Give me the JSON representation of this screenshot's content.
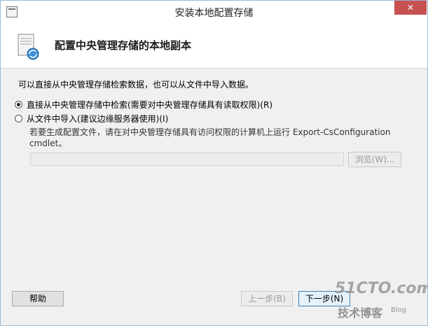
{
  "window": {
    "title": "安装本地配置存储",
    "close_label": "✕"
  },
  "header": {
    "title": "配置中央管理存储的本地副本"
  },
  "intro_text": "可以直接从中央管理存储检索数据，也可以从文件中导入数据。",
  "options": [
    {
      "label": "直接从中央管理存储中检索(需要对中央管理存储具有读取权限)(R)",
      "checked": true
    },
    {
      "label": "从文件中导入(建议边缘服务器使用)(I)",
      "checked": false
    }
  ],
  "import_description": "若要生成配置文件，请在对中央管理存储具有访问权限的计算机上运行 Export-CsConfiguration cmdlet。",
  "path_input": {
    "value": "",
    "placeholder": ""
  },
  "buttons": {
    "browse": "浏览(W)...",
    "help": "帮助",
    "back": "上一步(B)",
    "next": "下一步(N)"
  },
  "watermark": {
    "site": "51CTO.com",
    "tagline": "技术博客",
    "blog": "Blog"
  }
}
